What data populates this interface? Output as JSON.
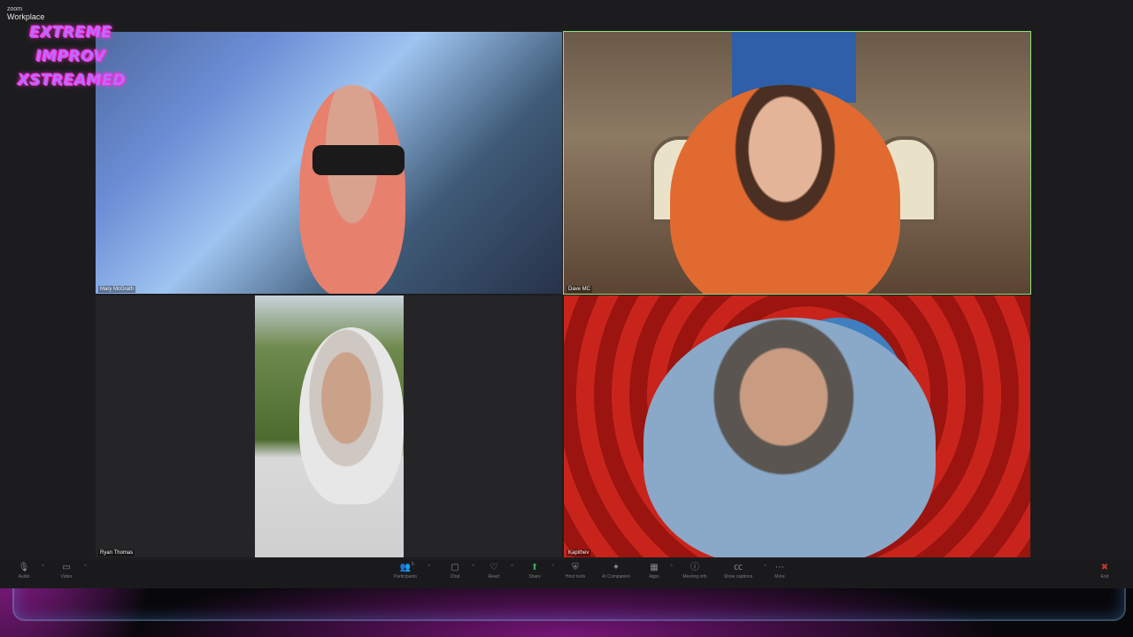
{
  "app": {
    "brand_small": "zoom",
    "brand_main": "Workplace"
  },
  "overlay": {
    "lines": [
      "EXTREME",
      "IMPROV",
      "XSTREAMED"
    ]
  },
  "participants": [
    {
      "name": "Mary McGrath"
    },
    {
      "name": "Dave MC"
    },
    {
      "name": "Ryan Thomas"
    },
    {
      "name": "Kapithev"
    }
  ],
  "toolbar": {
    "audio": {
      "label": "Audio",
      "icon": "mic-icon"
    },
    "video": {
      "label": "Video",
      "icon": "video-camera-icon"
    },
    "participants": {
      "label": "Participants",
      "icon": "participants-icon",
      "count": "5"
    },
    "chat": {
      "label": "Chat",
      "icon": "chat-icon"
    },
    "react": {
      "label": "React",
      "icon": "react-icon"
    },
    "share": {
      "label": "Share",
      "icon": "share-icon"
    },
    "host_tools": {
      "label": "Host tools",
      "icon": "shield-icon"
    },
    "ai_companion": {
      "label": "AI Companion",
      "icon": "sparkle-icon"
    },
    "apps": {
      "label": "Apps",
      "icon": "apps-icon"
    },
    "meeting_info": {
      "label": "Meeting info",
      "icon": "info-icon"
    },
    "captions": {
      "label": "Show captions",
      "icon": "cc-icon"
    },
    "more": {
      "label": "More",
      "icon": "more-icon"
    },
    "end": {
      "label": "End",
      "icon": "end-icon"
    }
  },
  "colors": {
    "active_speaker_border": "#8fe07a",
    "end_red": "#c0392b",
    "overlay_pink": "#ff2bd6",
    "overlay_purple": "#b86cff"
  }
}
